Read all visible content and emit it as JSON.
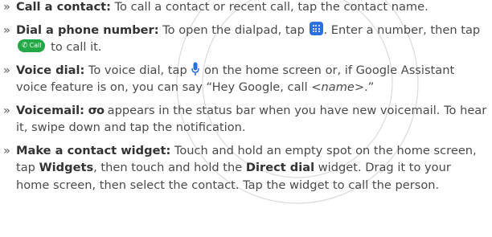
{
  "items": [
    {
      "term": "Call a contact:",
      "text": " To call a contact or recent call, tap the contact name."
    },
    {
      "term": "Dial a phone number:",
      "text_a": " To open the dialpad, tap ",
      "icon_a": "dialpad-icon",
      "text_b": ". Enter a number, then tap ",
      "call_button_label": "Call",
      "text_c": " to call it."
    },
    {
      "term": "Voice dial:",
      "text_a": " To voice dial, tap ",
      "icon_a": "microphone-icon",
      "text_b": " on the home screen or, if Google Assistant voice feature is on, you can say “Hey Google, call ",
      "placeholder": "<name>",
      "text_c": ".”"
    },
    {
      "term": "Voicemail:",
      "icon_glyph": "σο",
      "icon_name": "voicemail-icon",
      "text": " appears in the status bar when you have new voicemail. To hear it, swipe down and tap the notification."
    },
    {
      "term": "Make a contact widget:",
      "text_a": " Touch and hold an empty spot on the home screen, tap ",
      "bold_a": "Widgets",
      "text_b": ", then touch and hold the ",
      "bold_b": "Direct dial",
      "text_c": " widget. Drag it to your home screen, then select the contact. Tap the widget to call the person."
    }
  ],
  "bullet": "»",
  "colors": {
    "text": "#4a4a4a",
    "term": "#333333",
    "dialpad": "#2b6fe0",
    "call_button": "#22a845",
    "microphone": "#2b6fe0",
    "watermark": "#c8c8c8"
  }
}
